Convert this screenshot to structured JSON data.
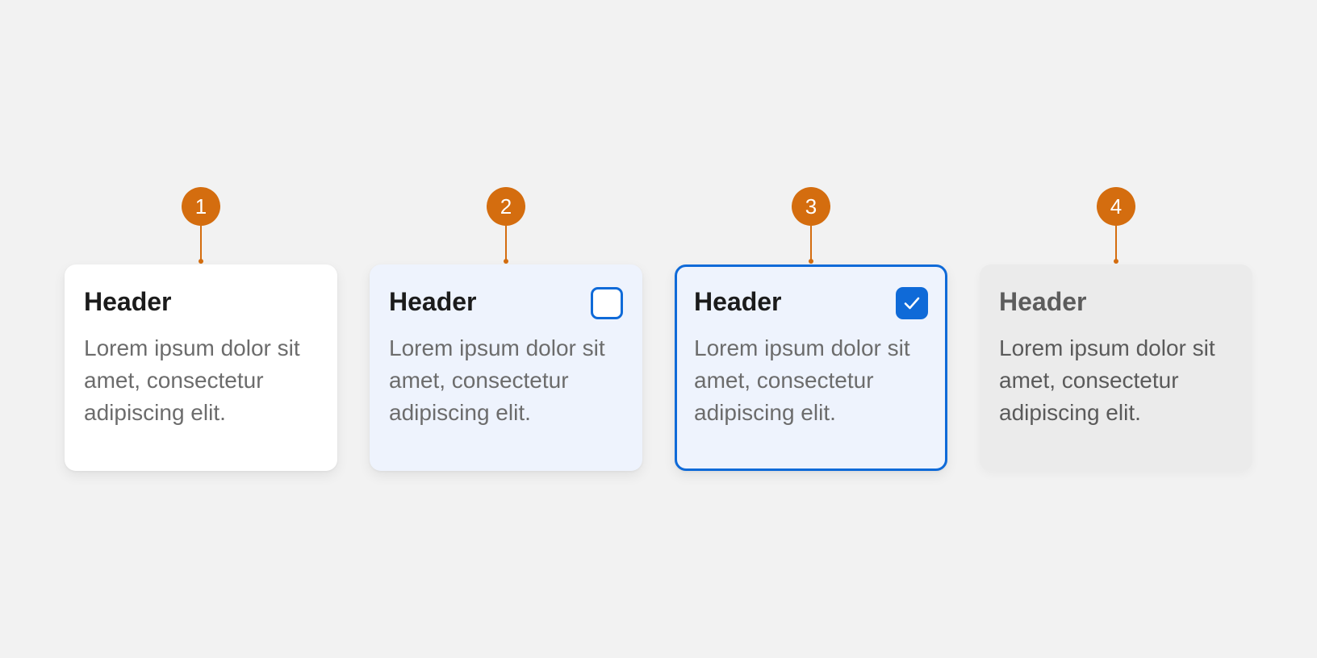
{
  "colors": {
    "background": "#f2f2f2",
    "marker": "#d46d0f",
    "accent_blue": "#0f6ad8",
    "hover_background": "#eef3fd",
    "disabled_background": "#ebebeb"
  },
  "cards": [
    {
      "marker": "1",
      "header": "Header",
      "body": "Lorem ipsum dolor sit amet, consectetur adipiscing elit.",
      "state": "default",
      "checkbox": "none"
    },
    {
      "marker": "2",
      "header": "Header",
      "body": "Lorem ipsum dolor sit amet, consectetur adipiscing elit.",
      "state": "hover",
      "checkbox": "unchecked"
    },
    {
      "marker": "3",
      "header": "Header",
      "body": "Lorem ipsum dolor sit amet, consectetur adipiscing elit.",
      "state": "selected",
      "checkbox": "checked",
      "checkbox_icon": "checkmark-icon"
    },
    {
      "marker": "4",
      "header": "Header",
      "body": "Lorem ipsum dolor sit amet, consectetur adipiscing elit.",
      "state": "disabled",
      "checkbox": "none"
    }
  ]
}
